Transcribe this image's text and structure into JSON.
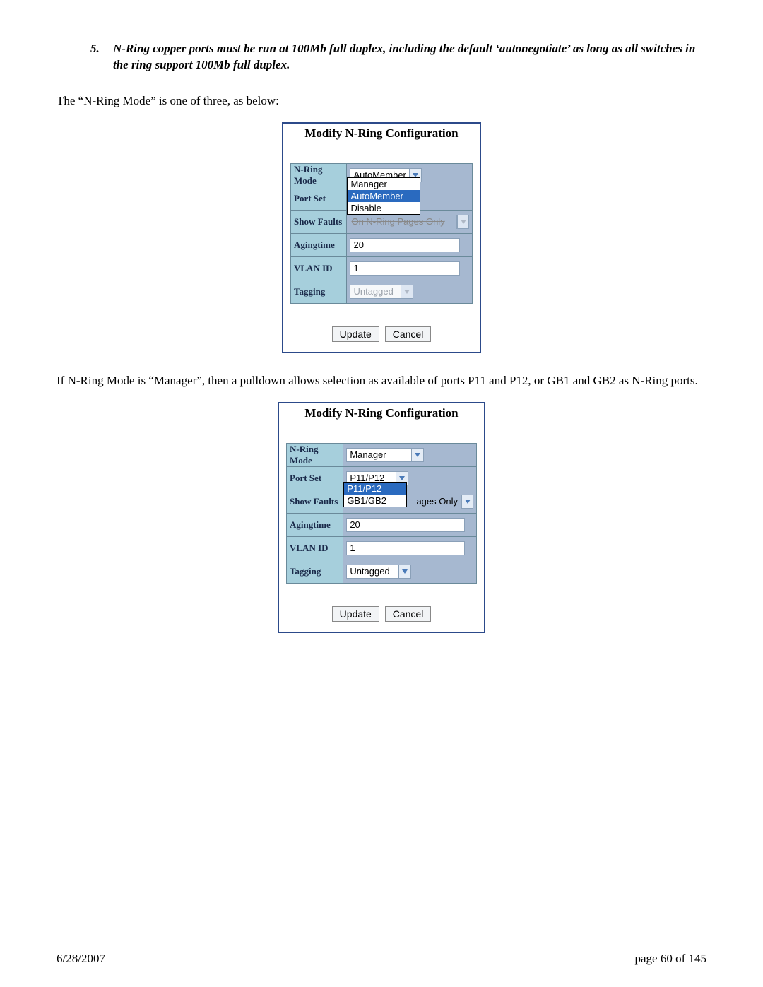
{
  "list": {
    "number": "5.",
    "text": "N-Ring copper ports must be run at 100Mb full duplex, including the default ‘autonegotiate’ as long as all switches in the ring support 100Mb full duplex."
  },
  "para1": "The “N-Ring Mode” is one of three, as below:",
  "para2": "If N-Ring Mode is “Manager”, then a pulldown allows selection as available of ports P11 and P12, or GB1 and GB2 as N-Ring ports.",
  "panelA": {
    "title": "Modify N-Ring Configuration",
    "rows": {
      "mode": {
        "label": "N-Ring Mode",
        "value": "AutoMember"
      },
      "portset": {
        "label": "Port Set"
      },
      "faults": {
        "label": "Show Faults"
      },
      "aging": {
        "label": "Agingtime",
        "value": "20"
      },
      "vlan": {
        "label": "VLAN ID",
        "value": "1"
      },
      "tag": {
        "label": "Tagging",
        "value": "Untagged"
      }
    },
    "dropdown": {
      "items": [
        "Manager",
        "AutoMember",
        "Disable"
      ],
      "selected": 1
    },
    "overflow_tail": "On N-Ring Pages Only",
    "overflow_tail_short": "nly",
    "buttons": {
      "update": "Update",
      "cancel": "Cancel"
    }
  },
  "panelB": {
    "title": "Modify N-Ring Configuration",
    "rows": {
      "mode": {
        "label": "N-Ring Mode",
        "value": "Manager"
      },
      "portset": {
        "label": "Port Set",
        "value": "P11/P12"
      },
      "faults": {
        "label": "Show Faults"
      },
      "aging": {
        "label": "Agingtime",
        "value": "20"
      },
      "vlan": {
        "label": "VLAN ID",
        "value": "1"
      },
      "tag": {
        "label": "Tagging",
        "value": "Untagged"
      }
    },
    "dropdown": {
      "items": [
        "P11/P12",
        "GB1/GB2"
      ],
      "selected": 0
    },
    "overflow_tail": "ages Only",
    "buttons": {
      "update": "Update",
      "cancel": "Cancel"
    }
  },
  "footer": {
    "date": "6/28/2007",
    "page": "page 60 of 145"
  }
}
